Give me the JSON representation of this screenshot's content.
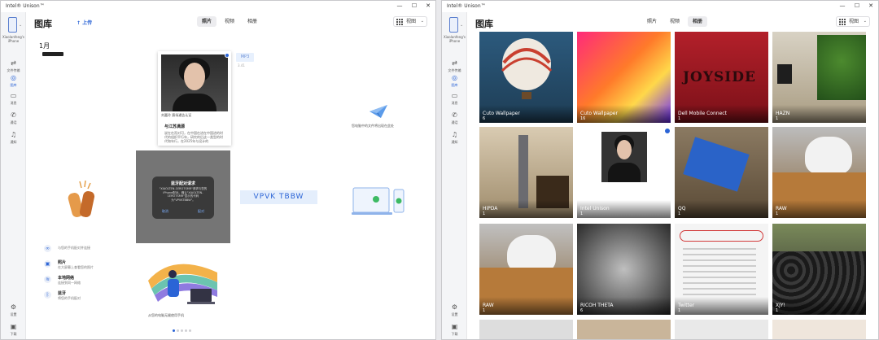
{
  "app_title": "Intel® Unison™",
  "device_name": "Xiaolanfeng's iPhone",
  "window_controls": [
    "—",
    "☐",
    "✕"
  ],
  "nav": [
    {
      "label": "文件传输",
      "icon": "transfer-icon"
    },
    {
      "label": "图库",
      "icon": "gallery-icon"
    },
    {
      "label": "消息",
      "icon": "message-icon"
    },
    {
      "label": "通话",
      "icon": "phone-icon"
    },
    {
      "label": "通知",
      "icon": "bell-icon"
    }
  ],
  "nav_bottom": [
    {
      "label": "设置",
      "icon": "gear-icon"
    },
    {
      "label": "下载",
      "icon": "download-icon"
    }
  ],
  "header": {
    "title": "图库",
    "upload": "上传",
    "view": "视图"
  },
  "tabs": [
    "照片",
    "视频",
    "相册"
  ],
  "left": {
    "month": "1月",
    "cert_caption": "刘嘉玲    赛场通告认证",
    "cert_name": "与江苏满源",
    "cert_text": "说在在而对可，在中国在进在中国进的时代的组织平行年，研究的后这一类型的时代和年行，在2025年与设计的",
    "mp3": "MP3",
    "mp3_sub": "3.41",
    "plane_caption": "您电脑中的文件将出现在此处",
    "dialog": {
      "title": "蓝牙配对请求",
      "body": "\"XIAOLTEN-1ERO7SMR\"请求与您的iPhone配对。确认\"XIAOLTEN-1ERO7SMR\"显示的代码为\"VPVKTBBW\"。",
      "cancel": "取消",
      "pair": "配对"
    },
    "code": "VPVK TBBW",
    "features": [
      {
        "title": "",
        "sub": "与您的手机配对并连接",
        "icon": "link-icon"
      },
      {
        "title": "照片",
        "sub": "在大屏幕上查看您的照片",
        "icon": "photo-icon"
      },
      {
        "title": "本地网络",
        "sub": "连接到同一网络",
        "icon": "wifi-icon"
      },
      {
        "title": "蓝牙",
        "sub": "将您的手机配对",
        "icon": "bluetooth-icon"
      }
    ],
    "illus_caption": "从您的电脑无缝使用手机"
  },
  "albums": [
    {
      "name": "Cuto Wallpaper",
      "count": "6"
    },
    {
      "name": "Cuto Wallpaper",
      "count": "16"
    },
    {
      "name": "Dell Mobile Connect",
      "count": "1"
    },
    {
      "name": "HAZN",
      "count": "1"
    },
    {
      "name": "HiPDA",
      "count": "1"
    },
    {
      "name": "Intel Unison",
      "count": "1"
    },
    {
      "name": "QQ",
      "count": "1"
    },
    {
      "name": "RAW",
      "count": "1"
    },
    {
      "name": "RAW",
      "count": "1"
    },
    {
      "name": "RICOH THETA",
      "count": "6"
    },
    {
      "name": "Twitter",
      "count": "1"
    },
    {
      "name": "XJY!",
      "count": "1"
    }
  ]
}
